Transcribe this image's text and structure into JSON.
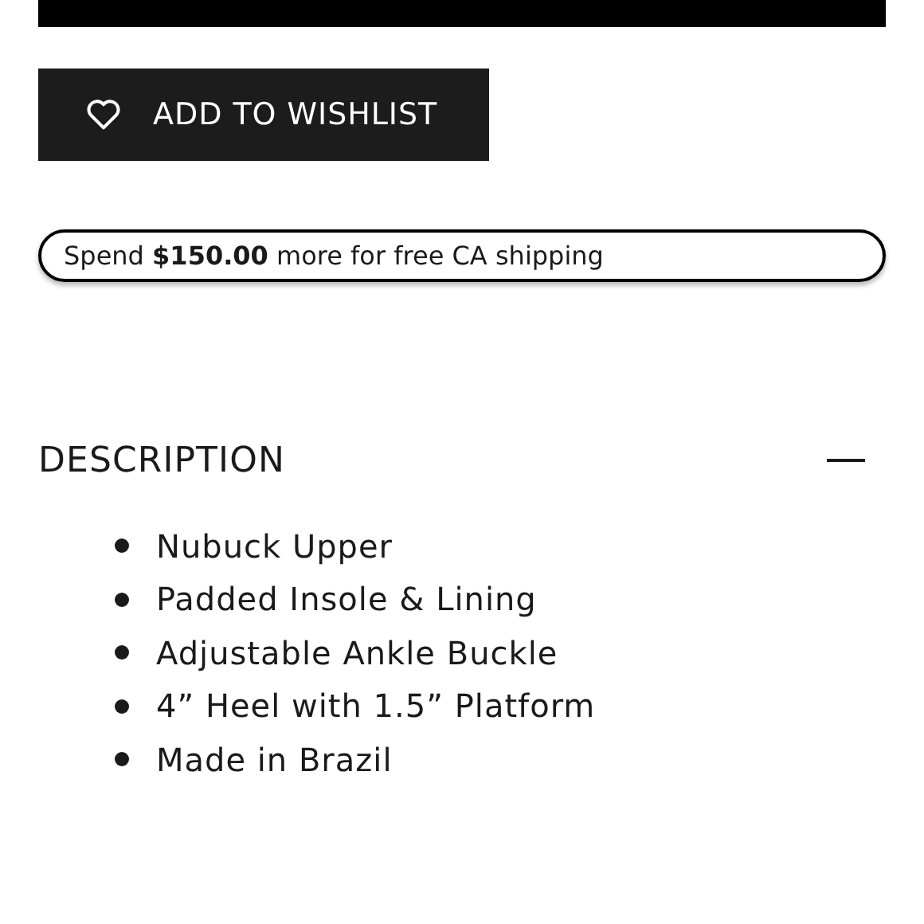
{
  "wishlist_button": {
    "label": "ADD TO WISHLIST"
  },
  "shipping_banner": {
    "text": "Spend **$150.00** more for free CA shipping"
  },
  "description": {
    "title": "DESCRIPTION",
    "expanded": true,
    "items": [
      "Nubuck Upper",
      "Padded Insole & Lining",
      "Adjustable Ankle Buckle",
      "4” Heel with 1.5” Platform",
      "Made in Brazil"
    ]
  }
}
